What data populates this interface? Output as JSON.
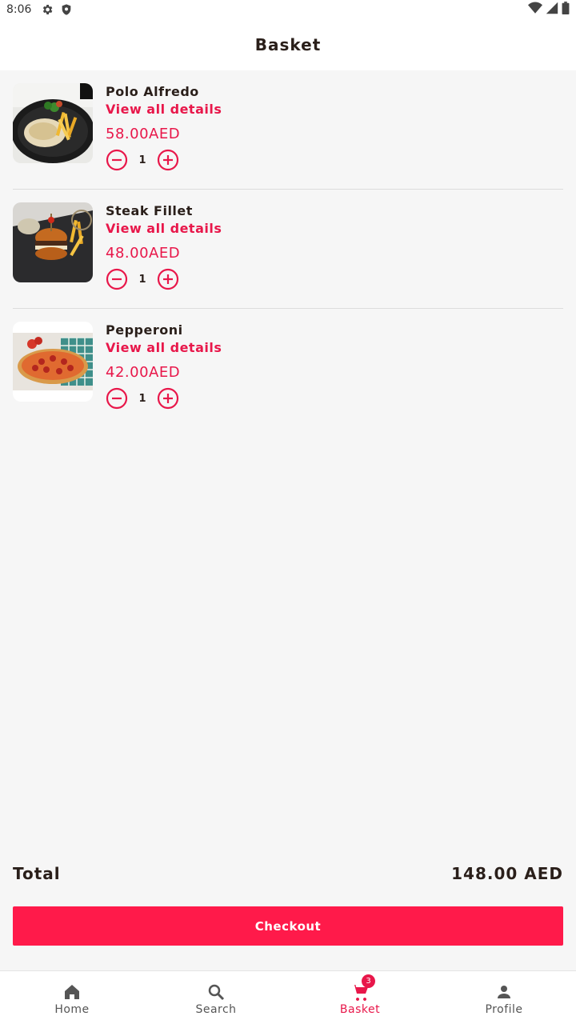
{
  "status_bar": {
    "time": "8:06"
  },
  "header": {
    "title": "Basket"
  },
  "items": [
    {
      "name": "Polo Alfredo",
      "details_label": "View all details",
      "price": "58.00AED",
      "quantity": "1"
    },
    {
      "name": "Steak Fillet",
      "details_label": "View all details",
      "price": "48.00AED",
      "quantity": "1"
    },
    {
      "name": "Pepperoni",
      "details_label": "View all details",
      "price": "42.00AED",
      "quantity": "1"
    }
  ],
  "summary": {
    "total_label": "Total",
    "total_value": "148.00 AED"
  },
  "checkout_label": "Checkout",
  "bottom_nav": {
    "items": [
      {
        "label": "Home",
        "icon": "home-icon"
      },
      {
        "label": "Search",
        "icon": "search-icon"
      },
      {
        "label": "Basket",
        "icon": "cart-icon",
        "badge": "3",
        "active": true
      },
      {
        "label": "Profile",
        "icon": "person-icon"
      }
    ]
  },
  "colors": {
    "accent": "#e8174a",
    "checkout": "#ff1a4a",
    "text": "#2a1f1a",
    "background": "#f6f6f6"
  }
}
